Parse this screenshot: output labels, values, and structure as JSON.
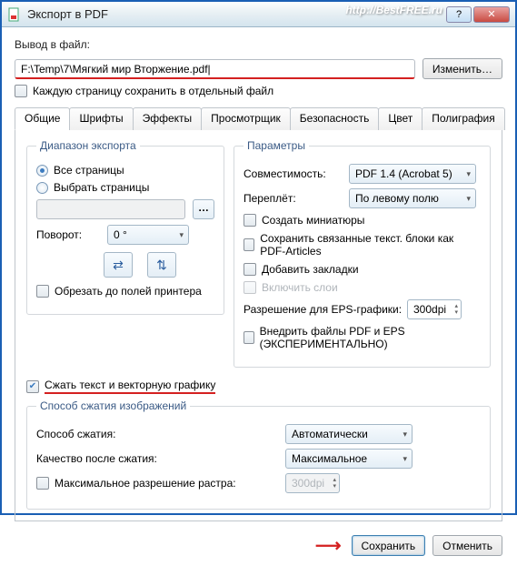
{
  "window": {
    "title": "Экспорт в PDF",
    "watermark": "http://BestFREE.ru"
  },
  "output": {
    "label": "Вывод в файл:",
    "path": "F:\\Temp\\7\\Мягкий мир Вторжение.pdf|",
    "change_btn": "Изменить…",
    "page_per_file": "Каждую страницу сохранить в отдельный файл"
  },
  "tabs": {
    "general": "Общие",
    "fonts": "Шрифты",
    "effects": "Эффекты",
    "viewer": "Просмотрщик",
    "security": "Безопасность",
    "color": "Цвет",
    "printing": "Полиграфия"
  },
  "range": {
    "legend": "Диапазон экспорта",
    "all": "Все страницы",
    "select": "Выбрать страницы",
    "rotation_label": "Поворот:",
    "rotation_value": "0 °",
    "crop": "Обрезать до полей принтера"
  },
  "params": {
    "legend": "Параметры",
    "compat_label": "Совместимость:",
    "compat_value": "PDF 1.4 (Acrobat 5)",
    "binding_label": "Переплёт:",
    "binding_value": "По левому полю",
    "thumbnails": "Создать миниатюры",
    "pdf_articles": "Сохранить связанные текст. блоки как PDF-Articles",
    "bookmarks": "Добавить закладки",
    "layers": "Включить слои",
    "eps_res_label": "Разрешение для EPS-графики:",
    "eps_res_value": "300dpi",
    "embed": "Внедрить файлы PDF и EPS (ЭКСПЕРИМЕНТАЛЬНО)"
  },
  "compress": {
    "vector": "Сжать текст и векторную графику",
    "legend": "Способ сжатия изображений",
    "method_label": "Способ сжатия:",
    "method_value": "Автоматически",
    "quality_label": "Качество после сжатия:",
    "quality_value": "Максимальное",
    "max_res_label": "Максимальное разрешение растра:",
    "max_res_value": "300dpi"
  },
  "footer": {
    "save": "Сохранить",
    "cancel": "Отменить"
  }
}
